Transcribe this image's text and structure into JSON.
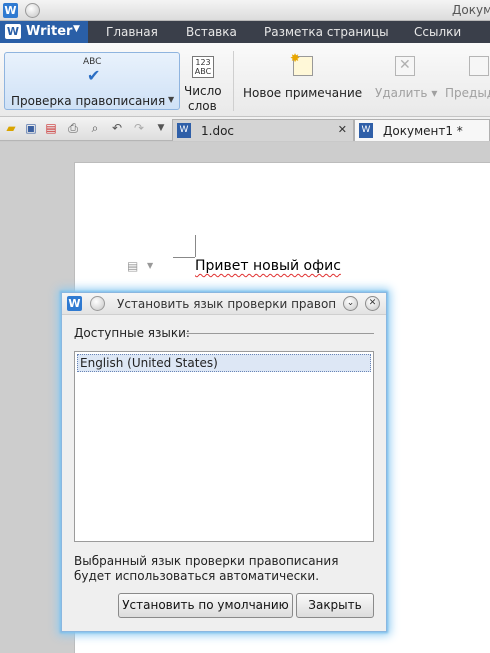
{
  "window": {
    "title": "Докум"
  },
  "menubar": {
    "app_button": "Writer",
    "tabs": [
      {
        "label": "Главная"
      },
      {
        "label": "Вставка"
      },
      {
        "label": "Разметка страницы"
      },
      {
        "label": "Ссылки"
      }
    ]
  },
  "ribbon": {
    "spellcheck_icon_text": "ABC",
    "spellcheck_label": "Проверка правописания",
    "wordcount_icon_top": "123",
    "wordcount_icon_bottom": "ABC",
    "wordcount_label_line1": "Число",
    "wordcount_label_line2": "слов",
    "new_note_label": "Новое примечание",
    "delete_label": "Удалить",
    "prev_label": "Предыд"
  },
  "doc_tabs": [
    {
      "icon": "W",
      "label": "1.doc"
    },
    {
      "icon": "W",
      "label": "Документ1 *"
    }
  ],
  "document": {
    "text": "Привет новый офис"
  },
  "dialog": {
    "title": "Установить язык проверки правописания",
    "group_label": "Доступные языки:",
    "languages": [
      {
        "label": "English (United States)",
        "selected": true
      }
    ],
    "info_text": "Выбранный язык проверки правописания будет использоваться автоматически.",
    "default_button": "Установить по умолчанию",
    "close_button": "Закрыть"
  },
  "colors": {
    "accent": "#2a5fa7",
    "menubar": "#3a3f4a",
    "dialog_glow": "#8ecbf2",
    "spell_underline": "#e03030"
  },
  "icons": [
    "writer-logo-icon",
    "window-menu-icon",
    "spellcheck-icon",
    "word-count-icon",
    "new-note-icon",
    "delete-note-icon",
    "prev-note-icon",
    "open-icon",
    "save-icon",
    "pdf-icon",
    "print-icon",
    "print-preview-icon",
    "undo-icon",
    "redo-icon",
    "customize-icon",
    "doc-icon",
    "close-icon",
    "paragraph-icon",
    "minimize-icon"
  ]
}
